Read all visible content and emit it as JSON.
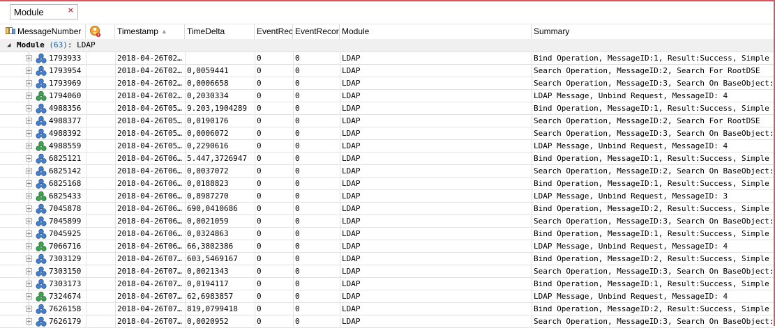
{
  "filter": {
    "label": "Module",
    "close_glyph": "×"
  },
  "columns": [
    {
      "key": "message_number",
      "label": "MessageNumber",
      "icon": "columns-icon"
    },
    {
      "key": "flag",
      "label": "",
      "icon": "error-flag-icon"
    },
    {
      "key": "timestamp",
      "label": "Timestamp",
      "sort": "ascending"
    },
    {
      "key": "time_delta",
      "label": "TimeDelta"
    },
    {
      "key": "event_record_1",
      "label": "EventReco"
    },
    {
      "key": "event_record_2",
      "label": "EventRecor"
    },
    {
      "key": "module",
      "label": "Module"
    },
    {
      "key": "summary",
      "label": "Summary"
    }
  ],
  "group": {
    "name": "Module",
    "count": "(63)",
    "value": "LDAP"
  },
  "icon_colors": {
    "request": "#3f7fd4",
    "response": "#3aa83a"
  },
  "rows": [
    {
      "id": "1793933",
      "ts": "2018-04-26T02…",
      "delta": "",
      "e1": "0",
      "e2": "0",
      "module": "LDAP",
      "summary": "Bind Operation, MessageID:1, Result:Success, Simple",
      "icon": "blue"
    },
    {
      "id": "1793954",
      "ts": "2018-04-26T02…",
      "delta": "0,0059441",
      "e1": "0",
      "e2": "0",
      "module": "LDAP",
      "summary": "Search Operation, MessageID:2, Search For RootDSE",
      "icon": "blue"
    },
    {
      "id": "1793969",
      "ts": "2018-04-26T02…",
      "delta": "0,0006658",
      "e1": "0",
      "e2": "0",
      "module": "LDAP",
      "summary": "Search Operation, MessageID:3, Search On BaseObject:",
      "icon": "blue"
    },
    {
      "id": "1794060",
      "ts": "2018-04-26T02…",
      "delta": "0,2030334",
      "e1": "0",
      "e2": "0",
      "module": "LDAP",
      "summary": "LDAP Message, Unbind Request, MessageID: 4",
      "icon": "green"
    },
    {
      "id": "4988356",
      "ts": "2018-04-26T05…",
      "delta": "9.203,1904289",
      "e1": "0",
      "e2": "0",
      "module": "LDAP",
      "summary": "Bind Operation, MessageID:1, Result:Success, Simple",
      "icon": "blue"
    },
    {
      "id": "4988377",
      "ts": "2018-04-26T05…",
      "delta": "0,0190176",
      "e1": "0",
      "e2": "0",
      "module": "LDAP",
      "summary": "Search Operation, MessageID:2, Search For RootDSE",
      "icon": "blue"
    },
    {
      "id": "4988392",
      "ts": "2018-04-26T05…",
      "delta": "0,0006072",
      "e1": "0",
      "e2": "0",
      "module": "LDAP",
      "summary": "Search Operation, MessageID:3, Search On BaseObject:",
      "icon": "blue"
    },
    {
      "id": "4988559",
      "ts": "2018-04-26T05…",
      "delta": "0,2290616",
      "e1": "0",
      "e2": "0",
      "module": "LDAP",
      "summary": "LDAP Message, Unbind Request, MessageID: 4",
      "icon": "green"
    },
    {
      "id": "6825121",
      "ts": "2018-04-26T06…",
      "delta": "5.447,3726947",
      "e1": "0",
      "e2": "0",
      "module": "LDAP",
      "summary": "Bind Operation, MessageID:1, Result:Success, Simple",
      "icon": "blue"
    },
    {
      "id": "6825142",
      "ts": "2018-04-26T06…",
      "delta": "0,0037072",
      "e1": "0",
      "e2": "0",
      "module": "LDAP",
      "summary": "Search Operation, MessageID:2, Search On BaseObject:",
      "icon": "blue"
    },
    {
      "id": "6825168",
      "ts": "2018-04-26T06…",
      "delta": "0,0188823",
      "e1": "0",
      "e2": "0",
      "module": "LDAP",
      "summary": "Bind Operation, MessageID:1, Result:Success, Simple",
      "icon": "blue"
    },
    {
      "id": "6825433",
      "ts": "2018-04-26T06…",
      "delta": "0,8987270",
      "e1": "0",
      "e2": "0",
      "module": "LDAP",
      "summary": "LDAP Message, Unbind Request, MessageID: 3",
      "icon": "green"
    },
    {
      "id": "7045878",
      "ts": "2018-04-26T06…",
      "delta": "690,0410686",
      "e1": "0",
      "e2": "0",
      "module": "LDAP",
      "summary": "Bind Operation, MessageID:2, Result:Success, Simple",
      "icon": "blue"
    },
    {
      "id": "7045899",
      "ts": "2018-04-26T06…",
      "delta": "0,0021059",
      "e1": "0",
      "e2": "0",
      "module": "LDAP",
      "summary": "Search Operation, MessageID:3, Search On BaseObject:",
      "icon": "blue"
    },
    {
      "id": "7045925",
      "ts": "2018-04-26T06…",
      "delta": "0,0324863",
      "e1": "0",
      "e2": "0",
      "module": "LDAP",
      "summary": "Bind Operation, MessageID:1, Result:Success, Simple",
      "icon": "blue"
    },
    {
      "id": "7066716",
      "ts": "2018-04-26T06…",
      "delta": "66,3802386",
      "e1": "0",
      "e2": "0",
      "module": "LDAP",
      "summary": "LDAP Message, Unbind Request, MessageID: 4",
      "icon": "green"
    },
    {
      "id": "7303129",
      "ts": "2018-04-26T07…",
      "delta": "603,5469167",
      "e1": "0",
      "e2": "0",
      "module": "LDAP",
      "summary": "Bind Operation, MessageID:2, Result:Success, Simple",
      "icon": "blue"
    },
    {
      "id": "7303150",
      "ts": "2018-04-26T07…",
      "delta": "0,0021343",
      "e1": "0",
      "e2": "0",
      "module": "LDAP",
      "summary": "Search Operation, MessageID:3, Search On BaseObject:",
      "icon": "blue"
    },
    {
      "id": "7303173",
      "ts": "2018-04-26T07…",
      "delta": "0,0194117",
      "e1": "0",
      "e2": "0",
      "module": "LDAP",
      "summary": "Bind Operation, MessageID:1, Result:Success, Simple",
      "icon": "blue"
    },
    {
      "id": "7324674",
      "ts": "2018-04-26T07…",
      "delta": "62,6983857",
      "e1": "0",
      "e2": "0",
      "module": "LDAP",
      "summary": "LDAP Message, Unbind Request, MessageID: 4",
      "icon": "green"
    },
    {
      "id": "7626158",
      "ts": "2018-04-26T07…",
      "delta": "819,0799418",
      "e1": "0",
      "e2": "0",
      "module": "LDAP",
      "summary": "Bind Operation, MessageID:2, Result:Success, Simple",
      "icon": "blue"
    },
    {
      "id": "7626179",
      "ts": "2018-04-26T07…",
      "delta": "0,0020952",
      "e1": "0",
      "e2": "0",
      "module": "LDAP",
      "summary": "Search Operation, MessageID:3, Search On BaseObject:",
      "icon": "blue"
    }
  ]
}
